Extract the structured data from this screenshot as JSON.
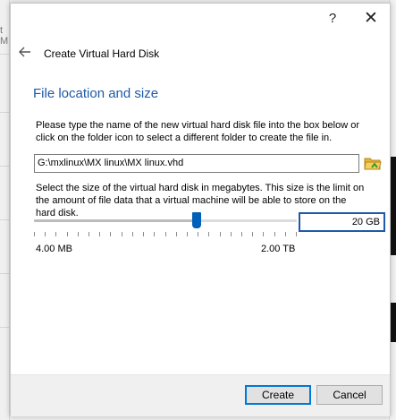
{
  "background": {
    "left_hint_text": "t M"
  },
  "titlebar": {
    "help_glyph": "?",
    "close_glyph": "✕"
  },
  "dialog": {
    "title": "Create Virtual Hard Disk",
    "heading": "File location and size",
    "location_description": "Please type the name of the new virtual hard disk file into the box below or click on the folder icon to select a different folder to create the file in.",
    "file_path": "G:\\mxlinux\\MX linux\\MX linux.vhd",
    "size_description": "Select the size of the virtual hard disk in megabytes. This size is the limit on the amount of file data that a virtual machine will be able to store on the hard disk.",
    "size_value": "20 GB",
    "size_fraction": 0.62,
    "min_label": "4.00 MB",
    "max_label": "2.00 TB",
    "tick_count": 25
  },
  "footer": {
    "create_label": "Create",
    "cancel_label": "Cancel"
  },
  "colors": {
    "accent": "#0078d7",
    "heading": "#1e5aa8",
    "slider_thumb": "#005fb8"
  },
  "icons": {
    "back": "back-arrow-icon",
    "folder": "folder-icon",
    "help": "help-icon",
    "close": "close-icon"
  }
}
